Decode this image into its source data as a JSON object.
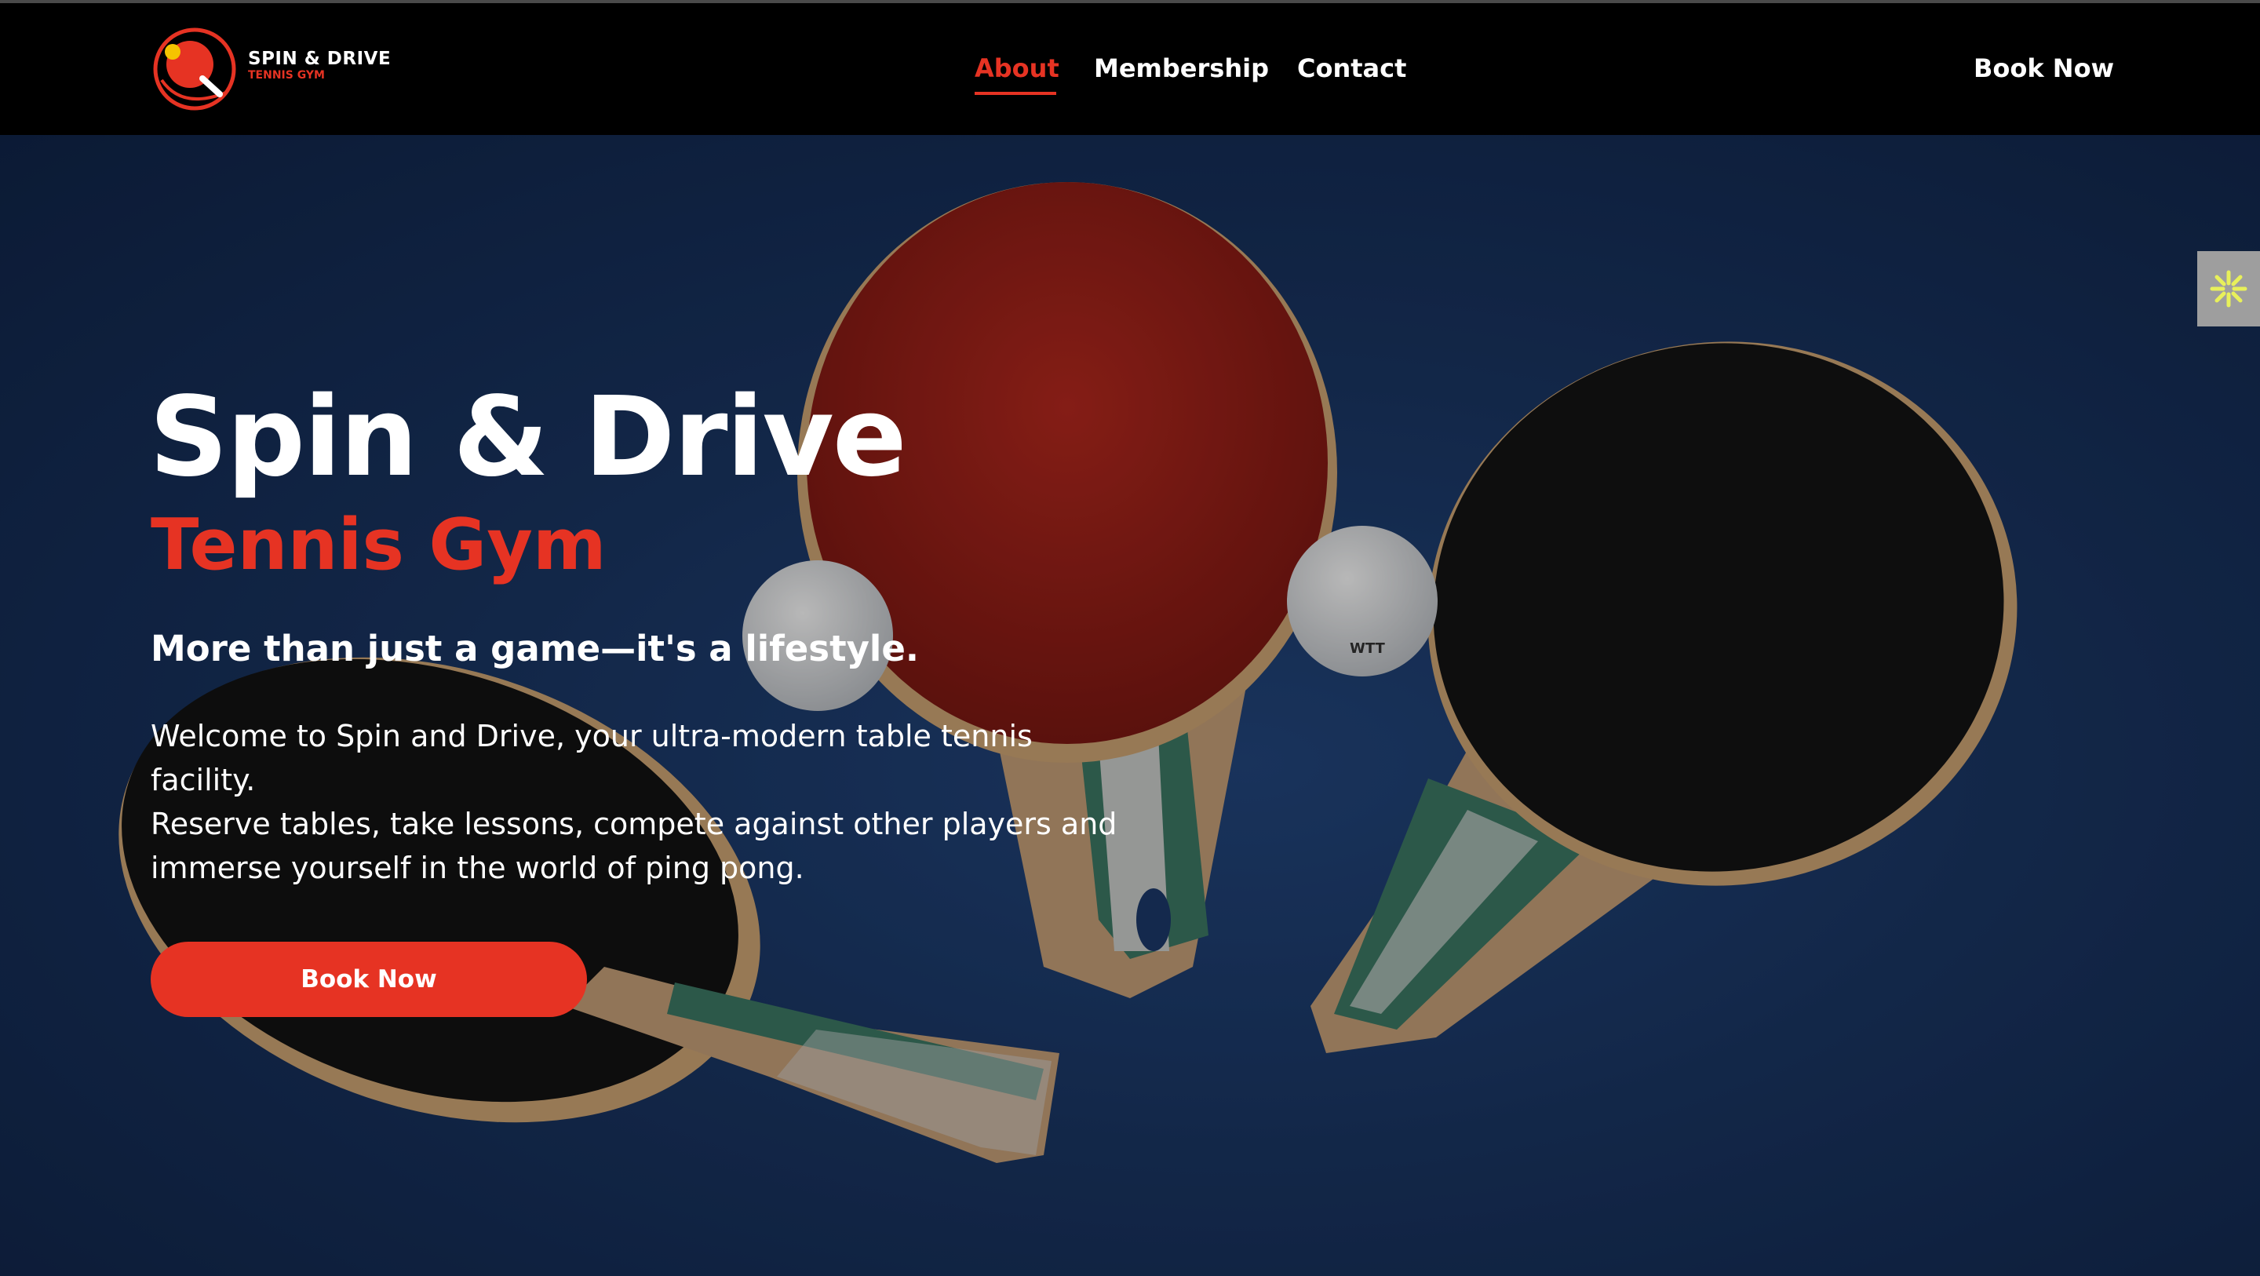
{
  "brand": {
    "name": "SPIN & DRIVE",
    "sub": "TENNIS GYM",
    "accent_color": "#e63323",
    "logo_icon": "ping-pong-paddle-icon"
  },
  "nav": {
    "items": [
      {
        "label": "About",
        "active": true
      },
      {
        "label": "Membership",
        "active": false
      },
      {
        "label": "Contact",
        "active": false
      }
    ],
    "cta_label": "Book Now"
  },
  "hero": {
    "title": "Spin & Drive",
    "subtitle": "Tennis Gym",
    "tagline": "More than just a game—it's a lifestyle.",
    "description_1": "Welcome to Spin and Drive, your ultra-modern table tennis facility.",
    "description_2": "Reserve tables, take lessons, compete against other players and immerse yourself in the world of ping pong.",
    "cta_label": "Book Now",
    "ball_brand": "WTT"
  },
  "side_widget": {
    "icon": "asterisk-icon"
  }
}
